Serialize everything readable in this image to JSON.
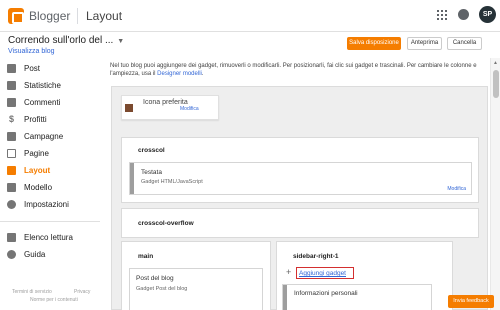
{
  "topbar": {
    "brand": "Blogger",
    "page_title": "Layout",
    "avatar_initials": "SP"
  },
  "blog": {
    "name": "Correndo sull'orlo del ...",
    "view_link": "Visualizza blog"
  },
  "toolbar": {
    "save_label": "Salva disposizione",
    "preview_label": "Anteprima",
    "cancel_label": "Cancella"
  },
  "sidebar": {
    "items": [
      {
        "label": "Post",
        "icon": "post-icon",
        "active": false
      },
      {
        "label": "Statistiche",
        "icon": "stats-icon",
        "active": false
      },
      {
        "label": "Commenti",
        "icon": "comments-icon",
        "active": false
      },
      {
        "label": "Profitti",
        "icon": "dollar-icon",
        "active": false
      },
      {
        "label": "Campagne",
        "icon": "campaigns-icon",
        "active": false
      },
      {
        "label": "Pagine",
        "icon": "pages-icon",
        "active": false
      },
      {
        "label": "Layout",
        "icon": "layout-icon",
        "active": true
      },
      {
        "label": "Modello",
        "icon": "template-icon",
        "active": false
      },
      {
        "label": "Impostazioni",
        "icon": "gear-icon",
        "active": false
      }
    ],
    "secondary": [
      {
        "label": "Elenco lettura",
        "icon": "reading-list-icon"
      },
      {
        "label": "Guida",
        "icon": "help-icon"
      }
    ],
    "footer": {
      "terms": "Termini di servizio",
      "privacy": "Privacy",
      "content_policy": "Norme per i contenuti"
    }
  },
  "intro": {
    "text": "Nel tuo blog puoi aggiungere dei gadget, rimuoverli o modificarli. Per posizionarli, fai clic sui gadget e trascinali. Per cambiare le colonne e l'ampiezza, usa il ",
    "link": "Designer modelli",
    "end": "."
  },
  "layout": {
    "favicon": {
      "title": "Icona preferita",
      "edit": "Modifica"
    },
    "crosscol": {
      "title": "crosscol",
      "widget": {
        "title": "Testata",
        "subtitle": "Gadget HTML/JavaScript",
        "edit": "Modifica"
      }
    },
    "crosscol_overflow": {
      "title": "crosscol-overflow"
    },
    "main": {
      "title": "main",
      "widget": {
        "title": "Post del blog",
        "subtitle": "Gadget Post del blog"
      }
    },
    "sidebar_right": {
      "title": "sidebar-right-1",
      "add_gadget": "Aggiungi gadget",
      "widget": {
        "title": "Informazioni personali"
      }
    }
  },
  "feedback": "Invia feedback",
  "colors": {
    "accent": "#f57d00",
    "link": "#3367d6",
    "highlight": "#d32f2f"
  }
}
